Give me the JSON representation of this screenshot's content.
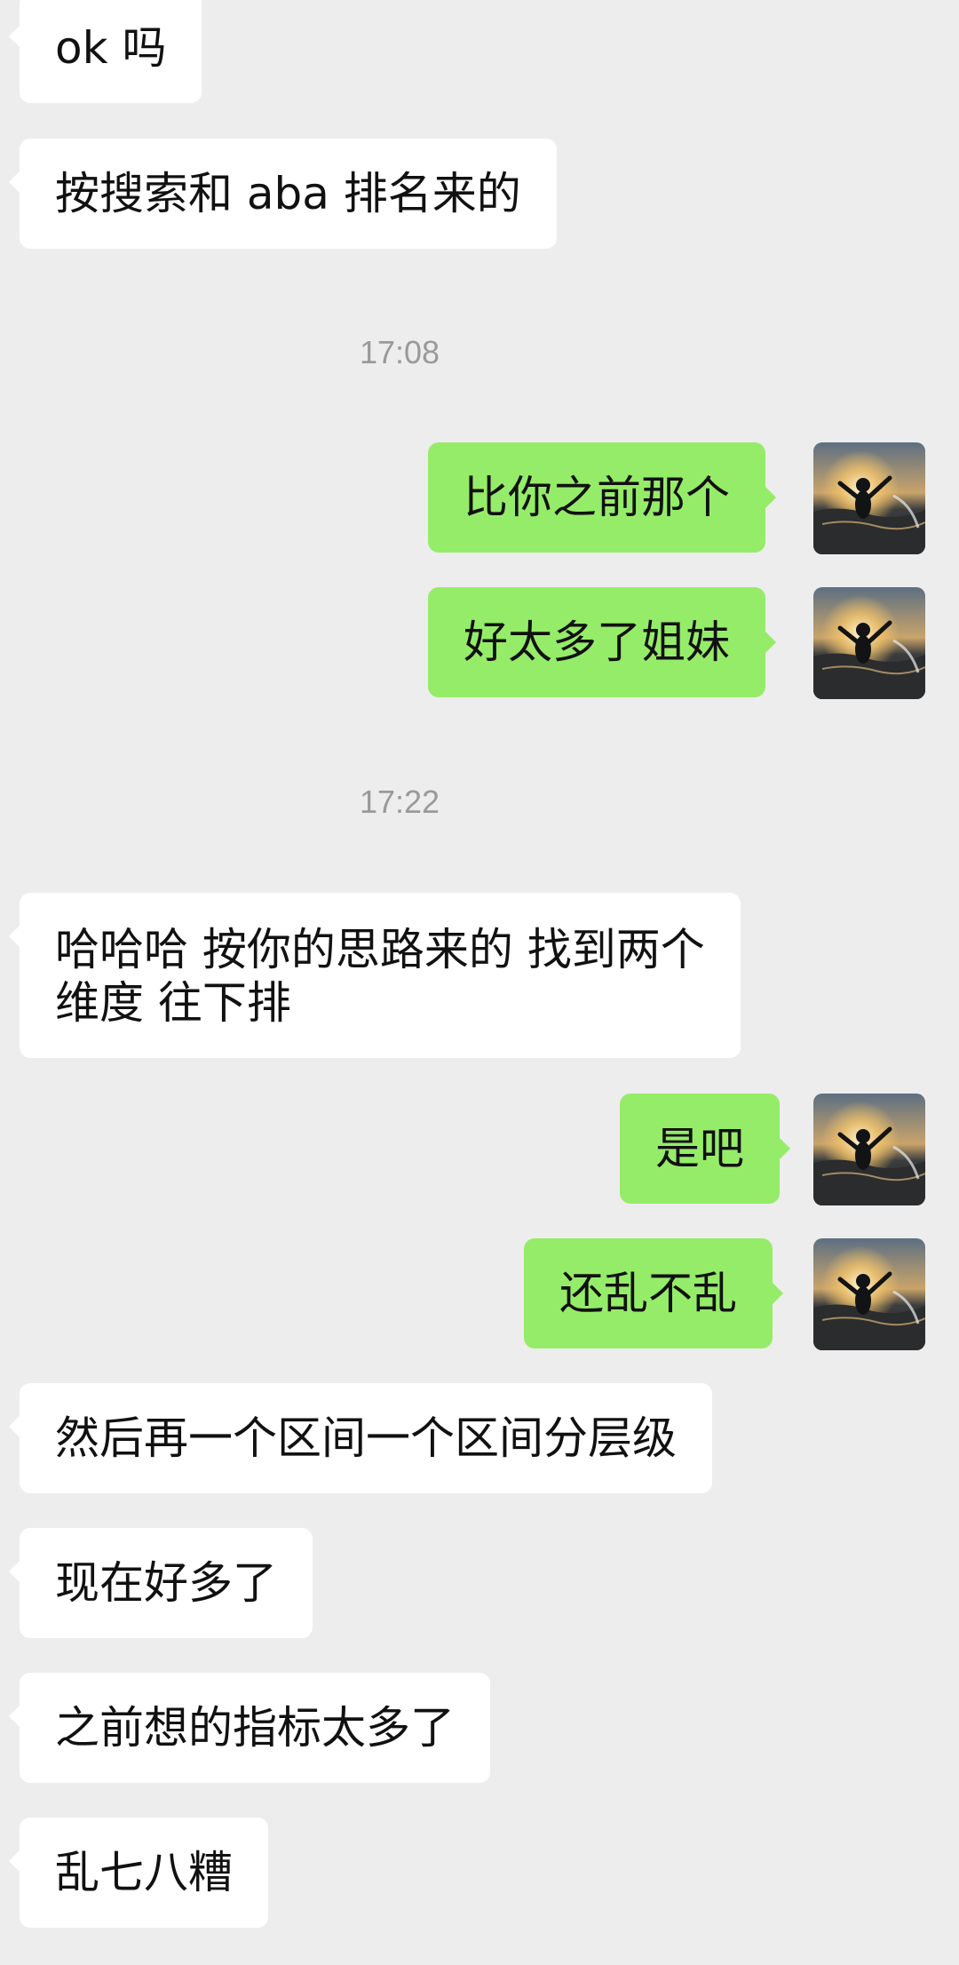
{
  "chat": {
    "colors": {
      "background": "#ededed",
      "incoming_bubble": "#ffffff",
      "outgoing_bubble": "#95ec69",
      "timestamp_text": "#9a9a9a"
    },
    "avatar_icon": "avatar-person-in-water-at-sunset",
    "messages": [
      {
        "type": "text",
        "direction": "in",
        "text": "ok 吗"
      },
      {
        "type": "text",
        "direction": "in",
        "text": "按搜索和 aba 排名来的"
      },
      {
        "type": "time",
        "text": "17:08"
      },
      {
        "type": "text",
        "direction": "out",
        "text": "比你之前那个"
      },
      {
        "type": "text",
        "direction": "out",
        "text": "好太多了姐妹"
      },
      {
        "type": "time",
        "text": "17:22"
      },
      {
        "type": "text",
        "direction": "in",
        "lines": [
          "哈哈哈 按你的思路来的 找到两个",
          "维度 往下排"
        ]
      },
      {
        "type": "text",
        "direction": "out",
        "text": "是吧"
      },
      {
        "type": "text",
        "direction": "out",
        "text": "还乱不乱"
      },
      {
        "type": "text",
        "direction": "in",
        "text": "然后再一个区间一个区间分层级"
      },
      {
        "type": "text",
        "direction": "in",
        "text": "现在好多了"
      },
      {
        "type": "text",
        "direction": "in",
        "text": "之前想的指标太多了"
      },
      {
        "type": "text",
        "direction": "in",
        "text": "乱七八糟"
      }
    ]
  }
}
